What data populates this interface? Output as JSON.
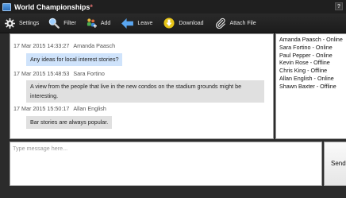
{
  "window": {
    "title": "World Championships",
    "dirty_marker": "*",
    "help_label": "?"
  },
  "toolbar": {
    "settings_label": "Settings",
    "filter_label": "Filter",
    "add_label": "Add",
    "leave_label": "Leave",
    "download_label": "Download",
    "attach_label": "Attach File"
  },
  "messages": [
    {
      "timestamp": "17 Mar 2015 14:33:27",
      "author": "Amanda Paasch",
      "text": "Any ideas for local interest stories?",
      "kind": "self"
    },
    {
      "timestamp": "17 Mar 2015 15:48:53",
      "author": "Sara Fortino",
      "text": "A view from the people that live in the new condos on the stadium grounds might be interesting.",
      "kind": "other"
    },
    {
      "timestamp": "17 Mar 2015 15:50:17",
      "author": "Allan English",
      "text": "Bar stories are always popular.",
      "kind": "other"
    }
  ],
  "users": [
    "Amanda Paasch - Online",
    "Sara Fortino - Online",
    "Paul Pepper - Online",
    "Kevin Rose - Offline",
    "Chris King - Offline",
    "Allan English - Online",
    "Shawn Baxter - Offline"
  ],
  "composer": {
    "placeholder": "Type message here...",
    "send_label": "Send"
  },
  "colors": {
    "self_bubble": "#cfe3fb",
    "other_bubble": "#e0e0e0",
    "toolbar_bg": "#1c1c1c",
    "dirty_marker": "#e07070"
  }
}
